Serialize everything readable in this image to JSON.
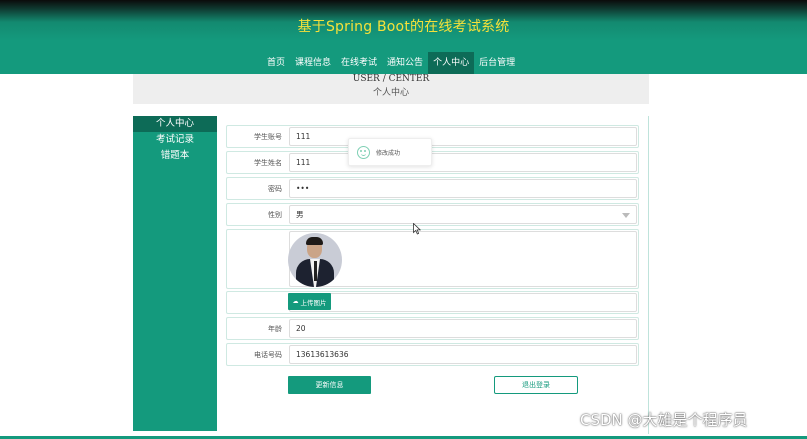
{
  "header": {
    "site_title": "基于Spring Boot的在线考试系统",
    "nav": [
      {
        "label": "首页",
        "active": false
      },
      {
        "label": "课程信息",
        "active": false
      },
      {
        "label": "在线考试",
        "active": false
      },
      {
        "label": "通知公告",
        "active": false
      },
      {
        "label": "个人中心",
        "active": true
      },
      {
        "label": "后台管理",
        "active": false
      }
    ]
  },
  "banner": {
    "title_en": "USER / CENTER",
    "title_cn": "个人中心"
  },
  "sidebar": {
    "items": [
      {
        "label": "个人中心",
        "active": true
      },
      {
        "label": "考试记录",
        "active": false
      },
      {
        "label": "错题本",
        "active": false
      }
    ]
  },
  "form": {
    "student_id": {
      "label": "学生账号",
      "value": "111"
    },
    "student_name": {
      "label": "学生姓名",
      "value": "111"
    },
    "password": {
      "label": "密码",
      "value": "•••"
    },
    "gender": {
      "label": "性别",
      "value": "男"
    },
    "upload_label": "上传图片",
    "age": {
      "label": "年龄",
      "value": "20"
    },
    "phone": {
      "label": "电话号码",
      "value": "13613613636"
    }
  },
  "toast": {
    "text": "修改成功"
  },
  "buttons": {
    "update": "更新信息",
    "logout": "退出登录"
  },
  "watermark": "CSDN @大雄是个程序员",
  "colors": {
    "primary": "#149a7d",
    "title": "#f5e13a",
    "active_nav": "#0d6b57"
  }
}
